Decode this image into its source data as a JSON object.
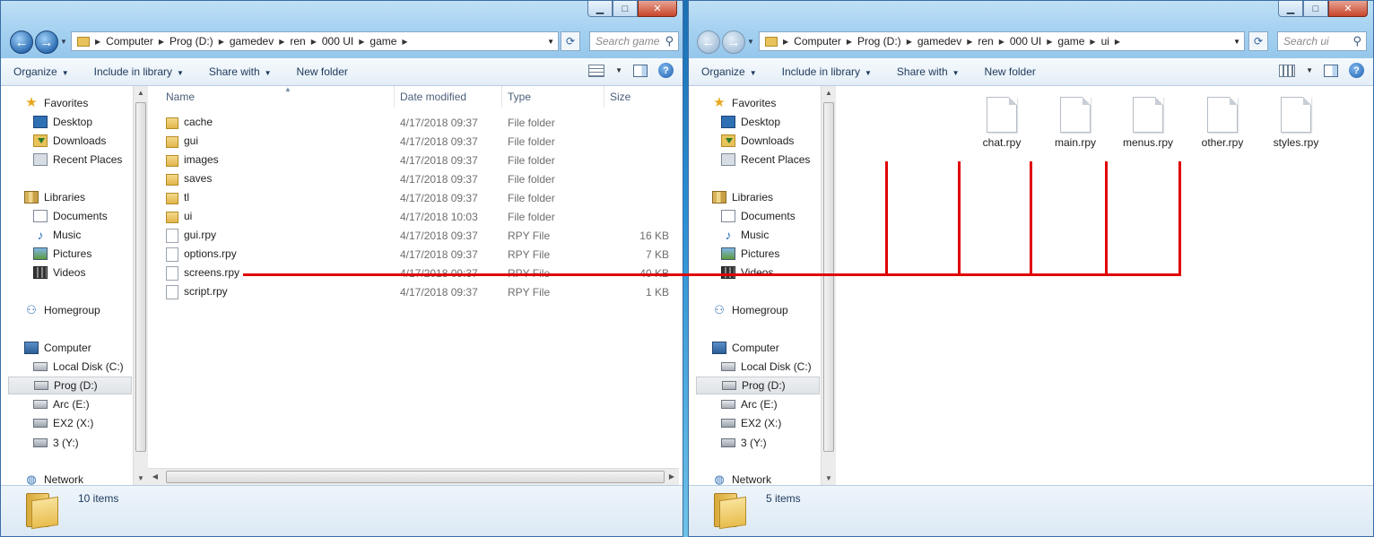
{
  "left_window": {
    "address": {
      "crumbs": [
        "Computer",
        "Prog (D:)",
        "gamedev",
        "ren",
        "000 UI",
        "game"
      ]
    },
    "search_placeholder": "Search game",
    "toolbar": {
      "organize": "Organize",
      "include": "Include in library",
      "share": "Share with",
      "new_folder": "New folder"
    },
    "columns": {
      "name": "Name",
      "date": "Date modified",
      "type": "Type",
      "size": "Size"
    },
    "files": [
      {
        "name": "cache",
        "date": "4/17/2018 09:37",
        "type": "File folder",
        "size": "",
        "kind": "folder"
      },
      {
        "name": "gui",
        "date": "4/17/2018 09:37",
        "type": "File folder",
        "size": "",
        "kind": "folder"
      },
      {
        "name": "images",
        "date": "4/17/2018 09:37",
        "type": "File folder",
        "size": "",
        "kind": "folder"
      },
      {
        "name": "saves",
        "date": "4/17/2018 09:37",
        "type": "File folder",
        "size": "",
        "kind": "folder"
      },
      {
        "name": "tl",
        "date": "4/17/2018 09:37",
        "type": "File folder",
        "size": "",
        "kind": "folder"
      },
      {
        "name": "ui",
        "date": "4/17/2018 10:03",
        "type": "File folder",
        "size": "",
        "kind": "folder"
      },
      {
        "name": "gui.rpy",
        "date": "4/17/2018 09:37",
        "type": "RPY File",
        "size": "16 KB",
        "kind": "file"
      },
      {
        "name": "options.rpy",
        "date": "4/17/2018 09:37",
        "type": "RPY File",
        "size": "7 KB",
        "kind": "file"
      },
      {
        "name": "screens.rpy",
        "date": "4/17/2018 09:37",
        "type": "RPY File",
        "size": "40 KB",
        "kind": "file"
      },
      {
        "name": "script.rpy",
        "date": "4/17/2018 09:37",
        "type": "RPY File",
        "size": "1 KB",
        "kind": "file"
      }
    ],
    "status": "10 items"
  },
  "right_window": {
    "address": {
      "crumbs": [
        "Computer",
        "Prog (D:)",
        "gamedev",
        "ren",
        "000 UI",
        "game",
        "ui"
      ]
    },
    "search_placeholder": "Search ui",
    "toolbar": {
      "organize": "Organize",
      "include": "Include in library",
      "share": "Share with",
      "new_folder": "New folder"
    },
    "files": [
      "chat.rpy",
      "main.rpy",
      "menus.rpy",
      "other.rpy",
      "styles.rpy"
    ],
    "status": "5 items"
  },
  "nav": {
    "favorites": "Favorites",
    "desktop": "Desktop",
    "downloads": "Downloads",
    "recent": "Recent Places",
    "libraries": "Libraries",
    "documents": "Documents",
    "music": "Music",
    "pictures": "Pictures",
    "videos": "Videos",
    "homegroup": "Homegroup",
    "computer": "Computer",
    "local_disk": "Local Disk (C:)",
    "prog": "Prog (D:)",
    "arc": "Arc (E:)",
    "ex2": "EX2 (X:)",
    "three": "3 (Y:)",
    "network": "Network"
  },
  "colors": {
    "connector": "#e00000",
    "accent": "#1e395b"
  }
}
